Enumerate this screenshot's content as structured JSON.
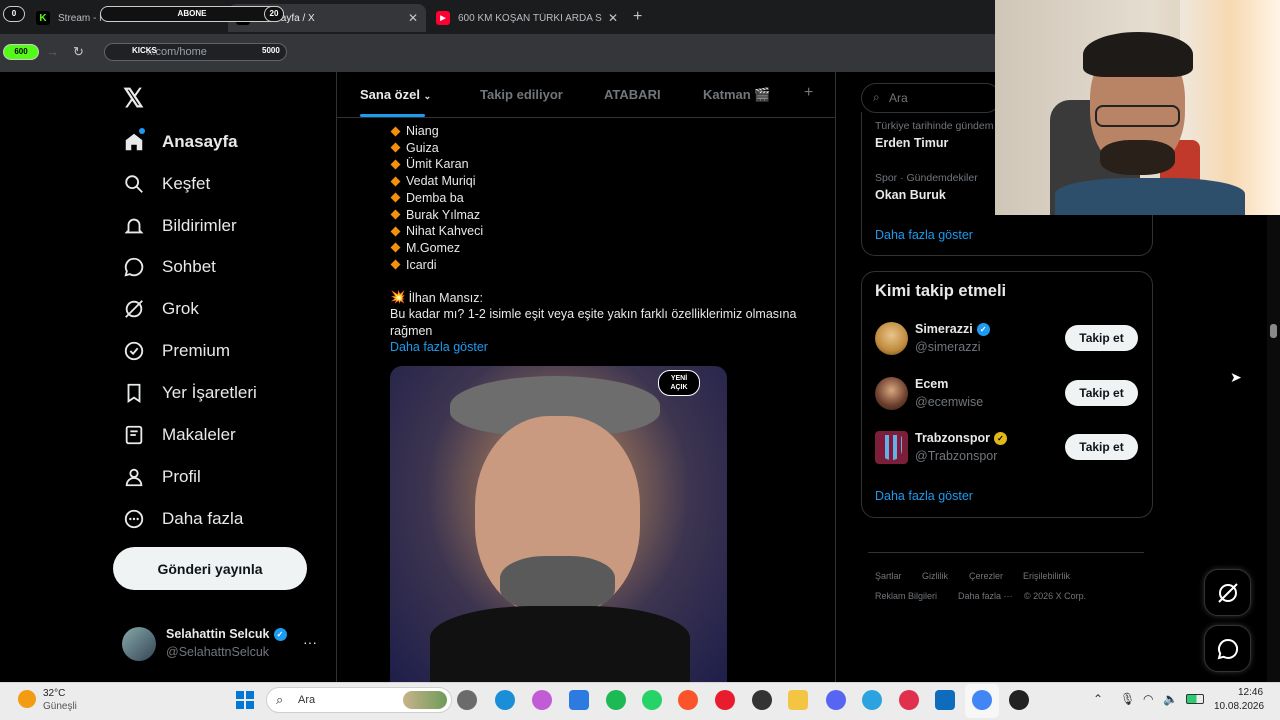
{
  "browser": {
    "tabs": [
      {
        "title": "Stream - Kick Dashboard",
        "icon": "kick-icon",
        "color": "#53fc18"
      },
      {
        "title": "Anasayfa / X",
        "icon": "x-icon",
        "color": "#ffffff"
      },
      {
        "title": "600 KM KOŞAN TÜRKİ ARDA S",
        "icon": "youtube-icon",
        "color": "#ff0033"
      }
    ],
    "url": "x.com/home",
    "overlay": {
      "left_counter": "0",
      "abone_label": "ABONE",
      "abone_count": "20",
      "progress_label": "600",
      "kicks_label": "KICKS",
      "kicks_goal": "5000"
    }
  },
  "nav": {
    "items": [
      {
        "label": "Anasayfa",
        "icon": "home-icon",
        "bold": true
      },
      {
        "label": "Keşfet",
        "icon": "search-icon"
      },
      {
        "label": "Bildirimler",
        "icon": "bell-icon"
      },
      {
        "label": "Sohbet",
        "icon": "chat-icon"
      },
      {
        "label": "Grok",
        "icon": "grok-icon"
      },
      {
        "label": "Premium",
        "icon": "premium-icon"
      },
      {
        "label": "Yer İşaretleri",
        "icon": "bookmark-icon"
      },
      {
        "label": "Makaleler",
        "icon": "article-icon"
      },
      {
        "label": "Profil",
        "icon": "profile-icon"
      },
      {
        "label": "Daha fazla",
        "icon": "more-circle-icon"
      }
    ],
    "post_button": "Gönderi yayınla",
    "account": {
      "name": "Selahattin Selcuk",
      "handle": "@SelahattnSelcuk",
      "more": "···"
    }
  },
  "feed": {
    "tabs": [
      "Sana özel",
      "Takip ediliyor",
      "ATABARI",
      "Katman 🎬"
    ],
    "add_tab": "+",
    "players": [
      "Niang",
      "Guiza",
      "Ümit Karan",
      "Vedat Muriqi",
      "Demba ba",
      "Burak Yılmaz",
      "Nihat Kahveci",
      "M.Gomez",
      "Icardi"
    ],
    "tweet_name": "İlhan Mansız:",
    "tweet_line1": "Bu kadar mı? 1-2 isimle eşit veya eşite yakın farklı özelliklerimiz olmasına",
    "tweet_line2": "rağmen",
    "show_more": "Daha fazla göster",
    "media_logo_line1": "YENİ",
    "media_logo_line2": "AÇIK"
  },
  "right": {
    "search_placeholder": "Ara",
    "trends": [
      {
        "category": "Türkiye tarihinde gündem",
        "name": "Erden Timur"
      },
      {
        "category": "Spor · Gündemdekiler",
        "name": "Okan Buruk"
      }
    ],
    "trends_show_more": "Daha fazla göster",
    "who_to_follow_title": "Kimi takip etmeli",
    "suggestions": [
      {
        "name": "Simerazzi",
        "handle": "@simerazzi",
        "badge": "blue",
        "button": "Takip et"
      },
      {
        "name": "Ecem",
        "handle": "@ecemwise",
        "badge": "",
        "button": "Takip et"
      },
      {
        "name": "Trabzonspor",
        "handle": "@Trabzonspor",
        "badge": "gold",
        "button": "Takip et"
      }
    ],
    "follow_show_more": "Daha fazla göster",
    "footer_row1": [
      "Şartlar",
      "Gizlilik",
      "Çerezler",
      "Erişilebilirlik"
    ],
    "footer_row2": [
      "Reklam Bilgileri",
      "Daha fazla ···",
      "© 2026 X Corp."
    ]
  },
  "taskbar": {
    "weather_temp": "32°C",
    "weather_desc": "Güneşli",
    "search_label": "Ara",
    "time": "12:46",
    "date": "10.08.2026"
  }
}
